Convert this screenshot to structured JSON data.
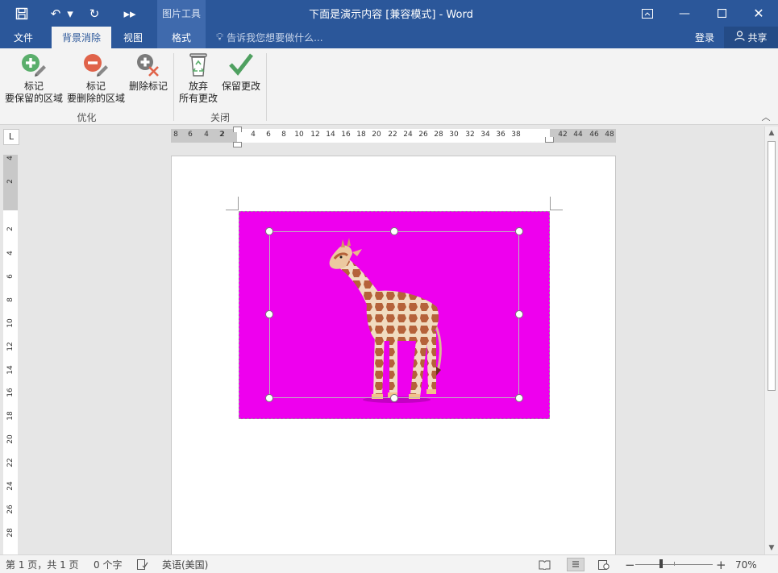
{
  "window": {
    "title": "下面是演示内容 [兼容模式] - Word",
    "context_tab_header": "图片工具"
  },
  "tabs": [
    {
      "label": "文件"
    },
    {
      "label": "背景消除",
      "active": true
    },
    {
      "label": "视图"
    },
    {
      "label": "格式"
    }
  ],
  "tell_me": {
    "placeholder": "告诉我您想要做什么..."
  },
  "account": {
    "signin": "登录",
    "share": "共享"
  },
  "ribbon": {
    "groups": [
      {
        "label": "优化",
        "buttons": [
          {
            "label_line1": "标记",
            "label_line2": "要保留的区域",
            "icon": "plus-circle-pencil-icon"
          },
          {
            "label_line1": "标记",
            "label_line2": "要删除的区域",
            "icon": "minus-circle-pencil-icon"
          },
          {
            "label_line1": "删除标记",
            "icon": "delete-mark-icon"
          }
        ]
      },
      {
        "label": "关闭",
        "buttons": [
          {
            "label_line1": "放弃",
            "label_line2": "所有更改",
            "icon": "recycle-bin-icon"
          },
          {
            "label_line1": "保留更改",
            "icon": "checkmark-icon"
          }
        ]
      }
    ]
  },
  "ruler": {
    "horizontal_ticks": [
      "8",
      "6",
      "4",
      "2",
      "2",
      "4",
      "6",
      "8",
      "10",
      "12",
      "14",
      "16",
      "18",
      "20",
      "22",
      "24",
      "26",
      "28",
      "30",
      "32",
      "34",
      "36",
      "38",
      "42",
      "44",
      "46",
      "48"
    ],
    "vertical_ticks": [
      "4",
      "2",
      "2",
      "4",
      "6",
      "8",
      "10",
      "12",
      "14",
      "16",
      "18",
      "20",
      "22",
      "24",
      "26",
      "28"
    ],
    "tab_selector": "L"
  },
  "status_bar": {
    "page": "第 1 页，共 1 页",
    "words": "0 个字",
    "language": "英语(美国)",
    "zoom": "70%"
  },
  "colors": {
    "title_bar": "#2b579a",
    "context_tab": "#3f6aad",
    "removal_area": "#ee00ee",
    "ribbon_bg": "#f3f3f3"
  }
}
